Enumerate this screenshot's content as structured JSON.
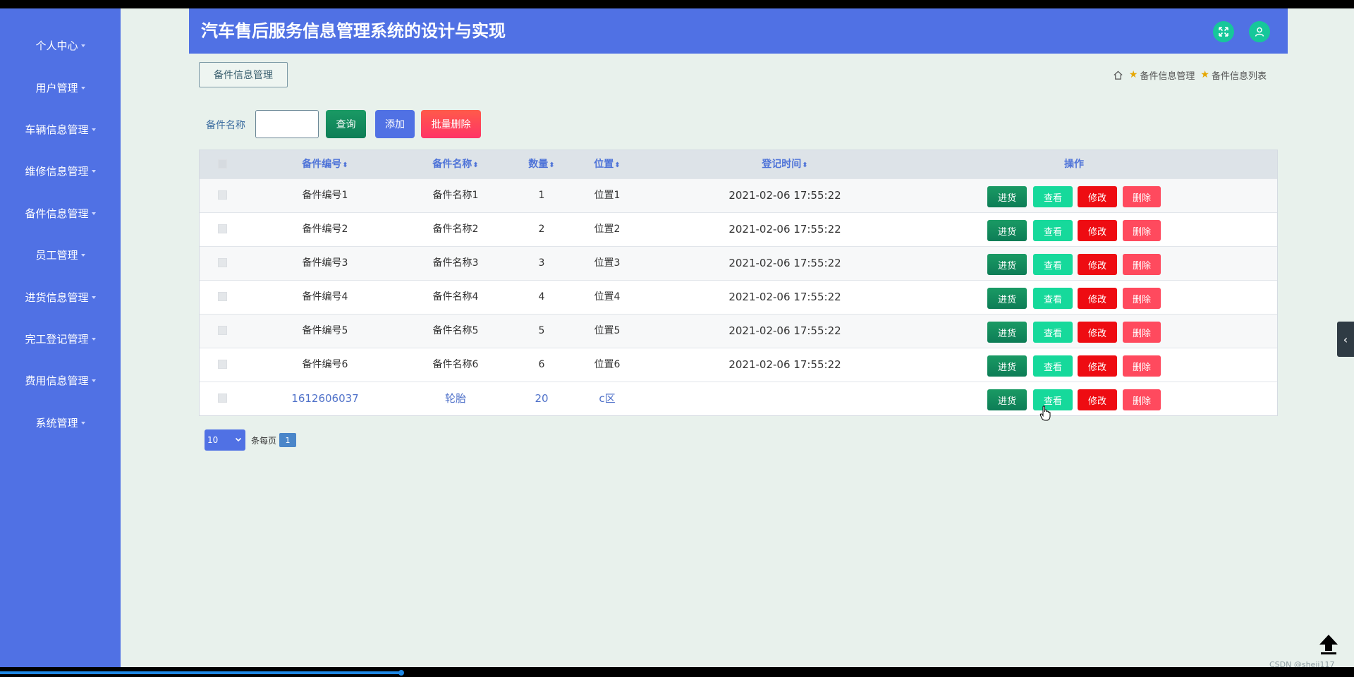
{
  "app": {
    "title": "汽车售后服务信息管理系统的设计与实现"
  },
  "sidebar": {
    "items": [
      {
        "label": "个人中心"
      },
      {
        "label": "用户管理"
      },
      {
        "label": "车辆信息管理"
      },
      {
        "label": "维修信息管理"
      },
      {
        "label": "备件信息管理"
      },
      {
        "label": "员工管理"
      },
      {
        "label": "进货信息管理"
      },
      {
        "label": "完工登记管理"
      },
      {
        "label": "费用信息管理"
      },
      {
        "label": "系统管理"
      }
    ]
  },
  "header": {
    "icons": [
      "fullscreen-icon",
      "user-icon"
    ],
    "accent": "#5071e4",
    "icon_bg": "#16c79a"
  },
  "module_tag": "备件信息管理",
  "breadcrumb": [
    "备件信息管理",
    "备件信息列表"
  ],
  "search": {
    "label": "备件名称",
    "value": "",
    "placeholder": "",
    "query_label": "查询",
    "add_label": "添加",
    "batch_delete_label": "批量删除"
  },
  "table": {
    "columns": [
      "备件编号",
      "备件名称",
      "数量",
      "位置",
      "登记时间",
      "操作"
    ],
    "actions": [
      "进货",
      "查看",
      "修改",
      "删除"
    ],
    "rows": [
      {
        "code": "备件编号1",
        "name": "备件名称1",
        "qty": "1",
        "location": "位置1",
        "time": "2021-02-06 17:55:22"
      },
      {
        "code": "备件编号2",
        "name": "备件名称2",
        "qty": "2",
        "location": "位置2",
        "time": "2021-02-06 17:55:22"
      },
      {
        "code": "备件编号3",
        "name": "备件名称3",
        "qty": "3",
        "location": "位置3",
        "time": "2021-02-06 17:55:22"
      },
      {
        "code": "备件编号4",
        "name": "备件名称4",
        "qty": "4",
        "location": "位置4",
        "time": "2021-02-06 17:55:22"
      },
      {
        "code": "备件编号5",
        "name": "备件名称5",
        "qty": "5",
        "location": "位置5",
        "time": "2021-02-06 17:55:22"
      },
      {
        "code": "备件编号6",
        "name": "备件名称6",
        "qty": "6",
        "location": "位置6",
        "time": "2021-02-06 17:55:22"
      },
      {
        "code": "1612606037",
        "name": "轮胎",
        "qty": "20",
        "location": "c区",
        "time": ""
      }
    ]
  },
  "pagination": {
    "page_size": "10",
    "per_page_label": "条每页",
    "current_page": "1"
  },
  "watermark": "CSDN @shejj117"
}
